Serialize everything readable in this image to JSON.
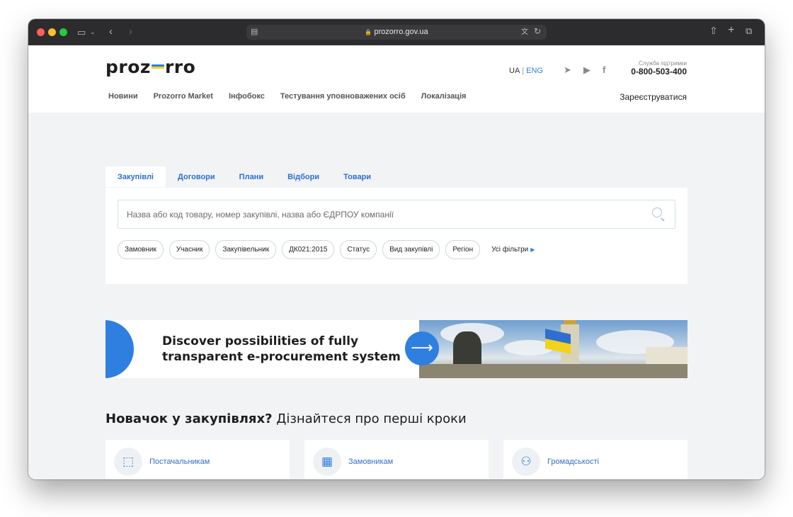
{
  "browser": {
    "url": "prozorro.gov.ua"
  },
  "header": {
    "logo_left": "proz",
    "logo_right": "rro",
    "lang": {
      "ua": "UA",
      "sep": "|",
      "en": "ENG"
    },
    "support_label": "Служба підтримки",
    "support_phone": "0-800-503-400",
    "nav": [
      "Новини",
      "Prozorro Market",
      "Інфобокс",
      "Тестування уповноважених осіб",
      "Локалізація"
    ],
    "register": "Зареєструватися"
  },
  "search": {
    "tabs": [
      "Закупівлі",
      "Договори",
      "Плани",
      "Відбори",
      "Товари"
    ],
    "active_tab": "Закупівлі",
    "placeholder": "Назва або код товару, номер закупівлі, назва або ЄДРПОУ компанії",
    "filters": [
      "Замовник",
      "Учасник",
      "Закупівельник",
      "ДК021:2015",
      "Статус",
      "Вид закупівлі",
      "Регіон"
    ],
    "all_filters": "Усі фільтри"
  },
  "banner": {
    "line1": "Discover possibilities of fully",
    "line2": "transparent e-procurement system"
  },
  "newbie": {
    "bold": "Новачок у закупівлях?",
    "rest": "Дізнайтеся про перші кроки",
    "cards": [
      "Постачальникам",
      "Замовникам",
      "Громадськості"
    ]
  },
  "colors": {
    "accent": "#2f7fe0",
    "link": "#2f6fc9",
    "bg": "#f2f3f5"
  }
}
